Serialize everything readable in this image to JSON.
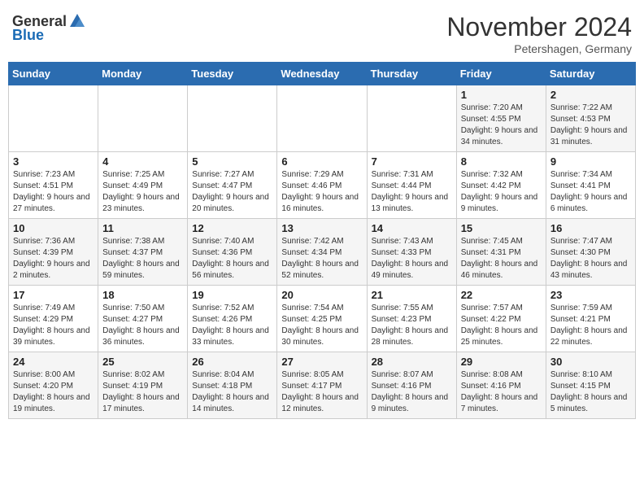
{
  "logo": {
    "general": "General",
    "blue": "Blue"
  },
  "title": "November 2024",
  "location": "Petershagen, Germany",
  "days_of_week": [
    "Sunday",
    "Monday",
    "Tuesday",
    "Wednesday",
    "Thursday",
    "Friday",
    "Saturday"
  ],
  "weeks": [
    [
      {
        "day": "",
        "detail": ""
      },
      {
        "day": "",
        "detail": ""
      },
      {
        "day": "",
        "detail": ""
      },
      {
        "day": "",
        "detail": ""
      },
      {
        "day": "",
        "detail": ""
      },
      {
        "day": "1",
        "detail": "Sunrise: 7:20 AM\nSunset: 4:55 PM\nDaylight: 9 hours and 34 minutes."
      },
      {
        "day": "2",
        "detail": "Sunrise: 7:22 AM\nSunset: 4:53 PM\nDaylight: 9 hours and 31 minutes."
      }
    ],
    [
      {
        "day": "3",
        "detail": "Sunrise: 7:23 AM\nSunset: 4:51 PM\nDaylight: 9 hours and 27 minutes."
      },
      {
        "day": "4",
        "detail": "Sunrise: 7:25 AM\nSunset: 4:49 PM\nDaylight: 9 hours and 23 minutes."
      },
      {
        "day": "5",
        "detail": "Sunrise: 7:27 AM\nSunset: 4:47 PM\nDaylight: 9 hours and 20 minutes."
      },
      {
        "day": "6",
        "detail": "Sunrise: 7:29 AM\nSunset: 4:46 PM\nDaylight: 9 hours and 16 minutes."
      },
      {
        "day": "7",
        "detail": "Sunrise: 7:31 AM\nSunset: 4:44 PM\nDaylight: 9 hours and 13 minutes."
      },
      {
        "day": "8",
        "detail": "Sunrise: 7:32 AM\nSunset: 4:42 PM\nDaylight: 9 hours and 9 minutes."
      },
      {
        "day": "9",
        "detail": "Sunrise: 7:34 AM\nSunset: 4:41 PM\nDaylight: 9 hours and 6 minutes."
      }
    ],
    [
      {
        "day": "10",
        "detail": "Sunrise: 7:36 AM\nSunset: 4:39 PM\nDaylight: 9 hours and 2 minutes."
      },
      {
        "day": "11",
        "detail": "Sunrise: 7:38 AM\nSunset: 4:37 PM\nDaylight: 8 hours and 59 minutes."
      },
      {
        "day": "12",
        "detail": "Sunrise: 7:40 AM\nSunset: 4:36 PM\nDaylight: 8 hours and 56 minutes."
      },
      {
        "day": "13",
        "detail": "Sunrise: 7:42 AM\nSunset: 4:34 PM\nDaylight: 8 hours and 52 minutes."
      },
      {
        "day": "14",
        "detail": "Sunrise: 7:43 AM\nSunset: 4:33 PM\nDaylight: 8 hours and 49 minutes."
      },
      {
        "day": "15",
        "detail": "Sunrise: 7:45 AM\nSunset: 4:31 PM\nDaylight: 8 hours and 46 minutes."
      },
      {
        "day": "16",
        "detail": "Sunrise: 7:47 AM\nSunset: 4:30 PM\nDaylight: 8 hours and 43 minutes."
      }
    ],
    [
      {
        "day": "17",
        "detail": "Sunrise: 7:49 AM\nSunset: 4:29 PM\nDaylight: 8 hours and 39 minutes."
      },
      {
        "day": "18",
        "detail": "Sunrise: 7:50 AM\nSunset: 4:27 PM\nDaylight: 8 hours and 36 minutes."
      },
      {
        "day": "19",
        "detail": "Sunrise: 7:52 AM\nSunset: 4:26 PM\nDaylight: 8 hours and 33 minutes."
      },
      {
        "day": "20",
        "detail": "Sunrise: 7:54 AM\nSunset: 4:25 PM\nDaylight: 8 hours and 30 minutes."
      },
      {
        "day": "21",
        "detail": "Sunrise: 7:55 AM\nSunset: 4:23 PM\nDaylight: 8 hours and 28 minutes."
      },
      {
        "day": "22",
        "detail": "Sunrise: 7:57 AM\nSunset: 4:22 PM\nDaylight: 8 hours and 25 minutes."
      },
      {
        "day": "23",
        "detail": "Sunrise: 7:59 AM\nSunset: 4:21 PM\nDaylight: 8 hours and 22 minutes."
      }
    ],
    [
      {
        "day": "24",
        "detail": "Sunrise: 8:00 AM\nSunset: 4:20 PM\nDaylight: 8 hours and 19 minutes."
      },
      {
        "day": "25",
        "detail": "Sunrise: 8:02 AM\nSunset: 4:19 PM\nDaylight: 8 hours and 17 minutes."
      },
      {
        "day": "26",
        "detail": "Sunrise: 8:04 AM\nSunset: 4:18 PM\nDaylight: 8 hours and 14 minutes."
      },
      {
        "day": "27",
        "detail": "Sunrise: 8:05 AM\nSunset: 4:17 PM\nDaylight: 8 hours and 12 minutes."
      },
      {
        "day": "28",
        "detail": "Sunrise: 8:07 AM\nSunset: 4:16 PM\nDaylight: 8 hours and 9 minutes."
      },
      {
        "day": "29",
        "detail": "Sunrise: 8:08 AM\nSunset: 4:16 PM\nDaylight: 8 hours and 7 minutes."
      },
      {
        "day": "30",
        "detail": "Sunrise: 8:10 AM\nSunset: 4:15 PM\nDaylight: 8 hours and 5 minutes."
      }
    ]
  ]
}
